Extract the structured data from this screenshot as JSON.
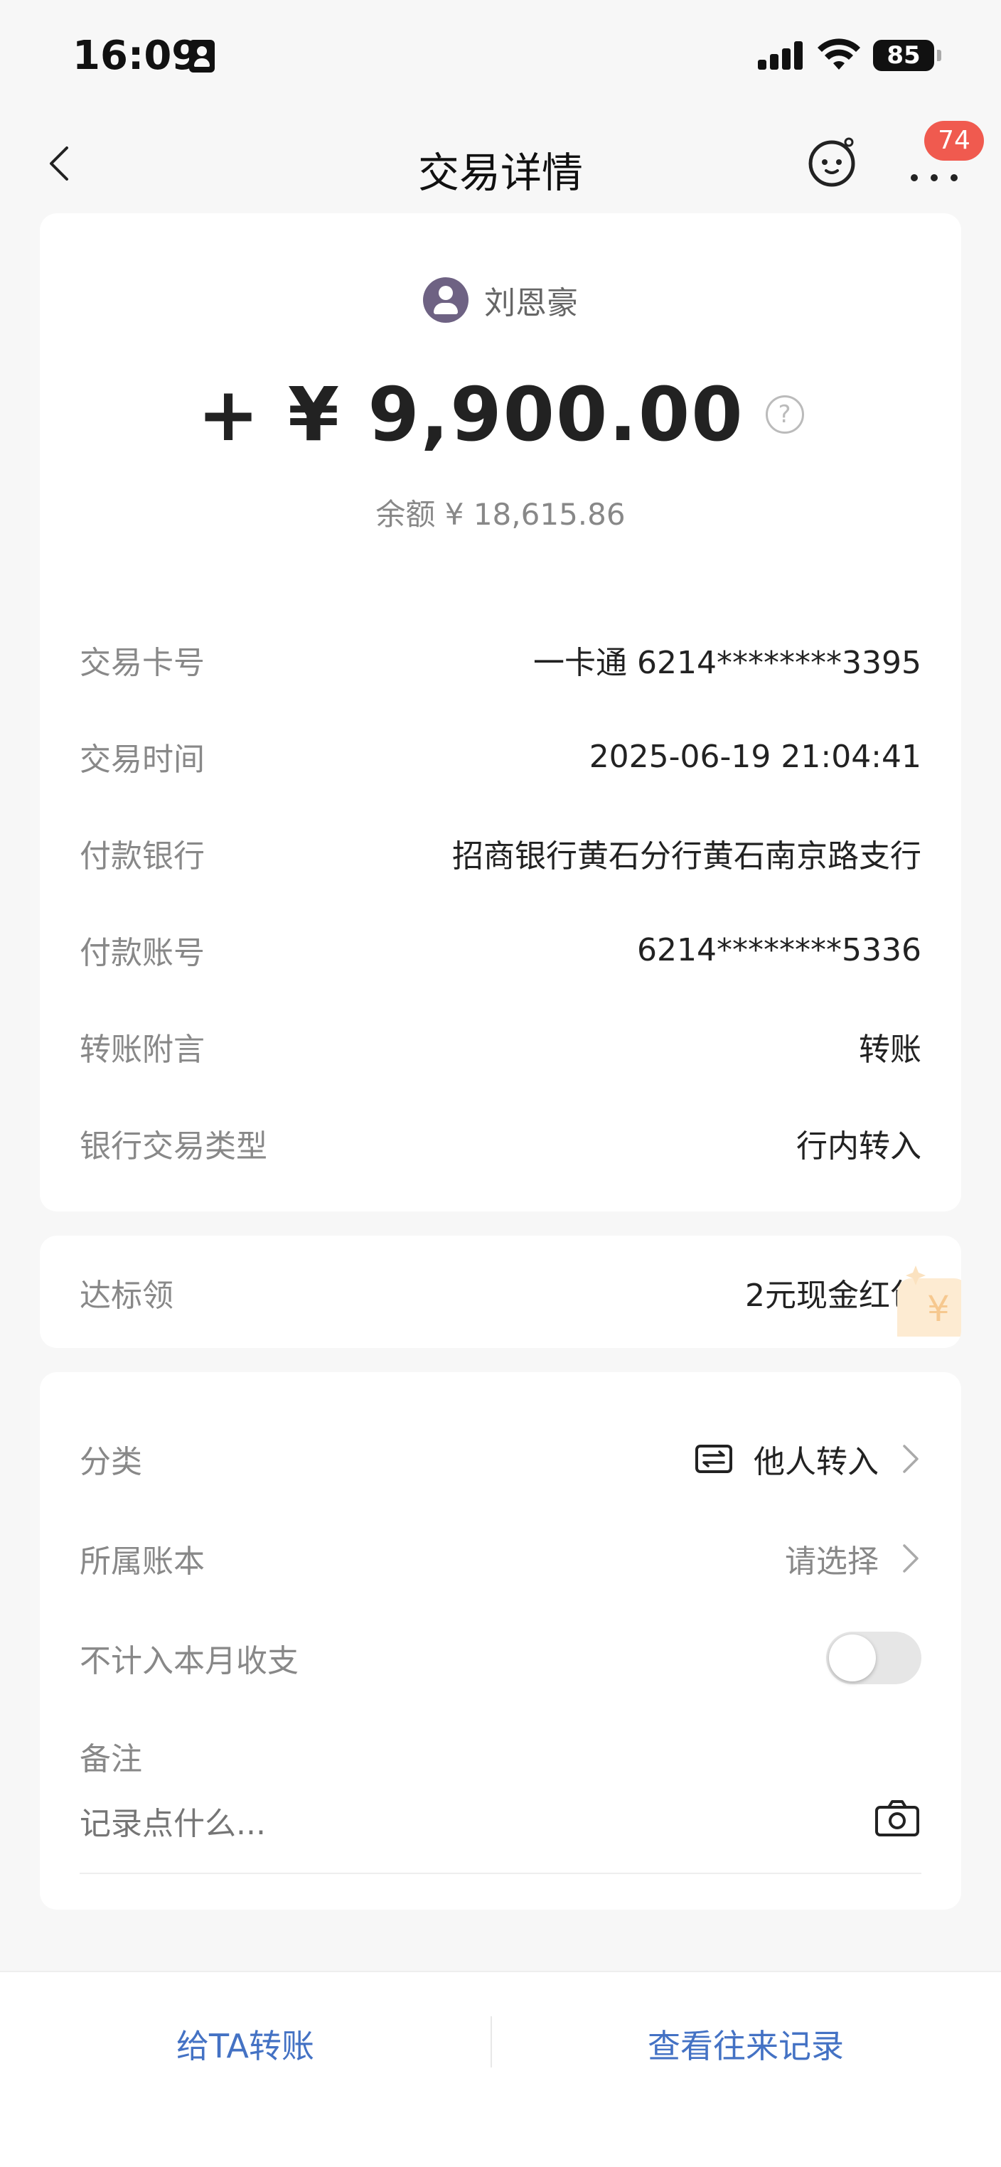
{
  "status_bar": {
    "time": "16:09",
    "battery": "85"
  },
  "nav": {
    "title": "交易详情",
    "badge_count": "74"
  },
  "transaction": {
    "payer_name": "刘恩豪",
    "amount": "+ ¥ 9,900.00",
    "balance": "余额 ¥ 18,615.86"
  },
  "details": [
    {
      "label": "交易卡号",
      "value": "一卡通 6214********3395"
    },
    {
      "label": "交易时间",
      "value": "2025-06-19 21:04:41"
    },
    {
      "label": "付款银行",
      "value": "招商银行黄石分行黄石南京路支行"
    },
    {
      "label": "付款账号",
      "value": "6214********5336"
    },
    {
      "label": "转账附言",
      "value": "转账"
    },
    {
      "label": "银行交易类型",
      "value": "行内转入"
    }
  ],
  "promo": {
    "label": "达标领",
    "value": "2元现金红包"
  },
  "category": {
    "label": "分类",
    "value": "他人转入",
    "book_label": "所属账本",
    "book_value": "请选择",
    "exclude_label": "不计入本月收支",
    "memo_label": "备注",
    "memo_placeholder": "记录点什么..."
  },
  "actions": {
    "transfer": "给TA转账",
    "history": "查看往来记录"
  },
  "colors": {
    "link": "#4472c4",
    "badge": "#f05a4f",
    "avatar": "#6e6283"
  }
}
